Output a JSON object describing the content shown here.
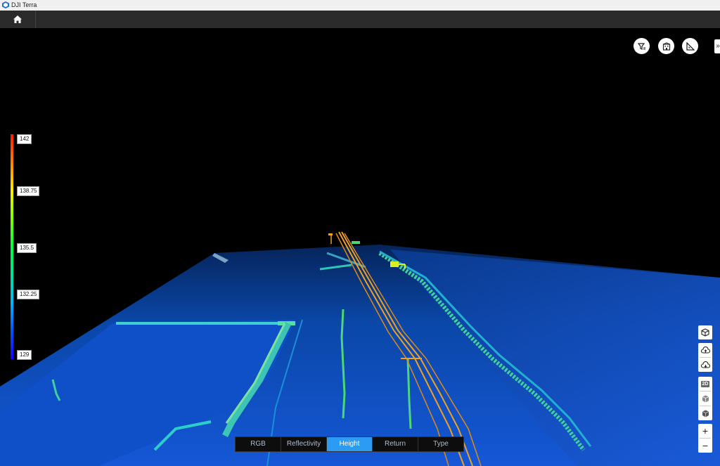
{
  "app": {
    "title": "DJI Terra"
  },
  "scale": {
    "ticks": [
      "142",
      "138.75",
      "135.5",
      "132.25",
      "129"
    ]
  },
  "modes": [
    {
      "label": "RGB",
      "active": false
    },
    {
      "label": "Reflectivity",
      "active": false
    },
    {
      "label": "Height",
      "active": true
    },
    {
      "label": "Return",
      "active": false
    },
    {
      "label": "Type",
      "active": false
    }
  ],
  "right_tools": {
    "mode_2d": "2D",
    "zoom_in": "+",
    "zoom_out": "−"
  },
  "collapse_label": "»"
}
